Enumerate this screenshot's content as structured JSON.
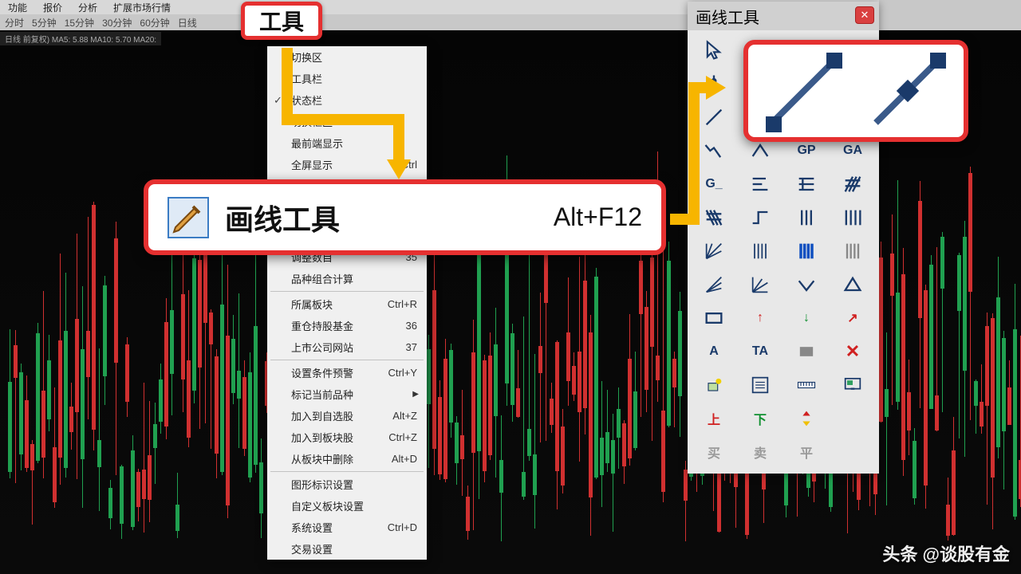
{
  "topbar": {
    "items": [
      "功能",
      "报价",
      "分析",
      "扩展市场行情"
    ]
  },
  "timeframes": [
    "分时",
    "5分钟",
    "15分钟",
    "30分钟",
    "60分钟",
    "日线"
  ],
  "ma_line": "日线 前复权) MA5: 5.88 MA10: 5.70 MA20:",
  "tools_button": "工具",
  "menu": {
    "g1": [
      {
        "label": "切换区",
        "check": false
      },
      {
        "label": "工具栏",
        "check": false
      },
      {
        "label": "状态栏",
        "check": true
      },
      {
        "label": "切换框区",
        "check": false
      },
      {
        "label": "最前端显示",
        "check": false
      },
      {
        "label": "全屏显示",
        "check": false,
        "shortcut": "Ctrl"
      }
    ],
    "g2": [
      {
        "label": "调整数目",
        "shortcut": "35"
      },
      {
        "label": "品种组合计算"
      }
    ],
    "g3": [
      {
        "label": "所属板块",
        "shortcut": "Ctrl+R"
      },
      {
        "label": "重仓持股基金",
        "shortcut": "36"
      },
      {
        "label": "上市公司网站",
        "shortcut": "37"
      }
    ],
    "g4": [
      {
        "label": "设置条件预警",
        "shortcut": "Ctrl+Y"
      },
      {
        "label": "标记当前品种",
        "arrow": true
      },
      {
        "label": "加入到自选股",
        "shortcut": "Alt+Z"
      },
      {
        "label": "加入到板块股",
        "shortcut": "Ctrl+Z"
      },
      {
        "label": "从板块中删除",
        "shortcut": "Alt+D"
      }
    ],
    "g5": [
      {
        "label": "图形标识设置"
      },
      {
        "label": "自定义板块设置"
      },
      {
        "label": "系统设置",
        "shortcut": "Ctrl+D"
      },
      {
        "label": "交易设置"
      }
    ]
  },
  "hl_row": {
    "label": "画线工具",
    "shortcut": "Alt+F12"
  },
  "palette": {
    "title": "画线工具",
    "tool_labels": {
      "gp": "GP",
      "ga": "GA",
      "gc": "G_",
      "ta": "TA",
      "a": "A",
      "up": "上",
      "down": "下",
      "buy": "买",
      "sell": "卖",
      "ping": "平"
    }
  },
  "watermark": "头条 @谈股有金"
}
